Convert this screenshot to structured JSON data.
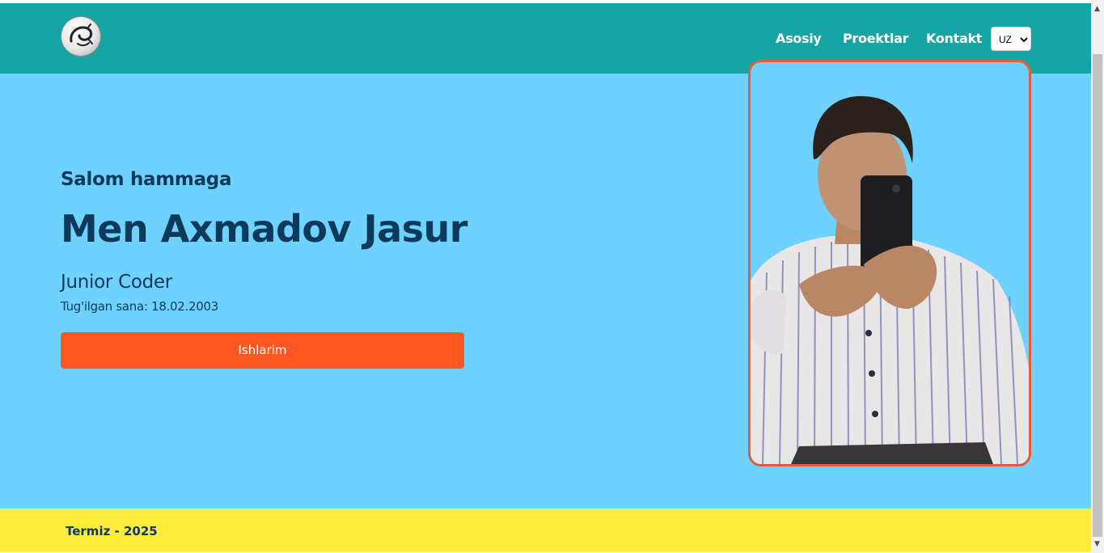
{
  "header": {
    "logo_icon": "dragon-logo-icon",
    "nav": [
      {
        "label": "Asosiy"
      },
      {
        "label": "Proektlar"
      },
      {
        "label": "Kontakt"
      }
    ],
    "language_select": {
      "value": "UZ"
    },
    "background": "#17a4a4"
  },
  "hero": {
    "greeting": "Salom hammaga",
    "name": "Men Axmadov Jasur",
    "role": "Junior Coder",
    "birth_date": "Tug'ilgan sana: 18.02.2003",
    "button_label": "Ishlarim",
    "background": "#6fd1fe",
    "button_color": "#ff5722",
    "photo_border_color": "#e65a3a"
  },
  "footer": {
    "text": "Termiz - 2025",
    "background": "#ffeb3b"
  }
}
